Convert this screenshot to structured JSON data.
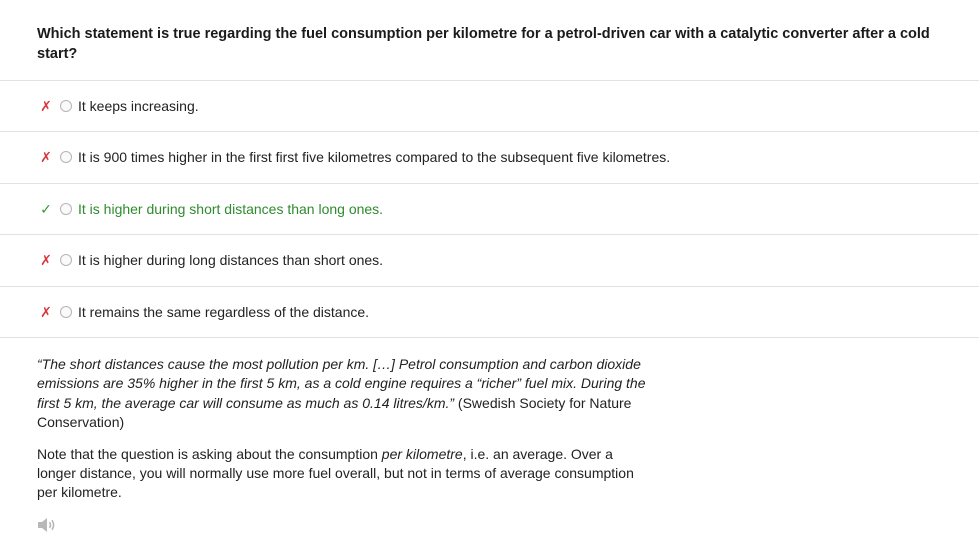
{
  "question": "Which statement is true regarding the fuel consumption per kilometre for a petrol-driven car with a catalytic converter after a cold start?",
  "options": [
    {
      "mark": "✗",
      "text": "It keeps increasing.",
      "correct": false
    },
    {
      "mark": "✗",
      "text": "It is 900 times higher in the first first five kilometres compared to the subsequent five kilometres.",
      "correct": false
    },
    {
      "mark": "✓",
      "text": "It is higher during short distances than long ones.",
      "correct": true
    },
    {
      "mark": "✗",
      "text": "It is higher during long distances than short ones.",
      "correct": false
    },
    {
      "mark": "✗",
      "text": "It remains the same regardless of the distance.",
      "correct": false
    }
  ],
  "explanation": {
    "quote": "“The short distances cause the most pollution per km. […] Petrol consumption and carbon dioxide emissions are 35% higher in the first 5 km, as a cold engine requires a “richer” fuel mix. During the first 5 km, the average car will consume as much as 0.14 litres/km.”",
    "source": " (Swedish Society for Nature Conservation)",
    "note_before": "Note that the question is asking about the consumption ",
    "note_emphasis": "per kilometre",
    "note_after": ", i.e. an average. Over a longer distance, you will normally use more fuel overall, but not in terms of average consumption per kilometre."
  },
  "icons": {
    "audio": "speaker-icon"
  },
  "colors": {
    "wrong": "#d9363e",
    "right": "#3a9a3a",
    "correct_text": "#2e8b2e"
  }
}
